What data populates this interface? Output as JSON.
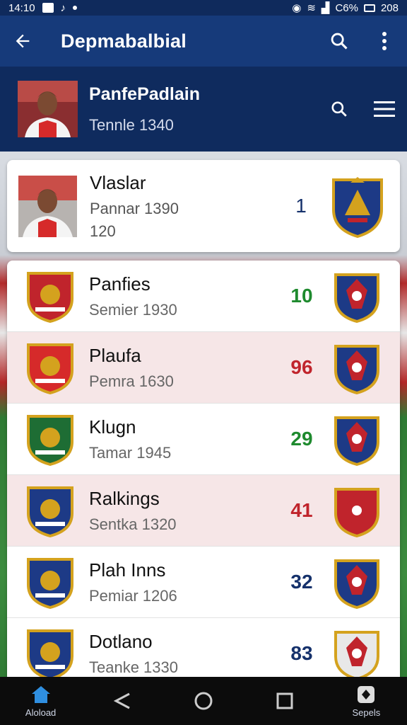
{
  "status_bar": {
    "time": "14:10",
    "battery": "C6%",
    "right_text": "208"
  },
  "app_bar": {
    "title": "Depmabalbial",
    "icons": [
      "back-arrow-icon",
      "search-icon",
      "more-vert-icon"
    ]
  },
  "profile": {
    "name": "PanfePadlain",
    "subtitle": "Tennle 1340",
    "icons": [
      "search-icon",
      "menu-icon"
    ]
  },
  "featured": {
    "name": "Vlaslar",
    "line1": "Pannar 1390",
    "line2": "120",
    "rank": "1"
  },
  "teams": [
    {
      "name": "Panfies",
      "sub": "Semier 1930",
      "value": "10",
      "color": "#1e8a2e",
      "alt": false
    },
    {
      "name": "Plaufa",
      "sub": "Pemra 1630",
      "value": "96",
      "color": "#c0242c",
      "alt": true
    },
    {
      "name": "Klugn",
      "sub": "Tamar 1945",
      "value": "29",
      "color": "#1e8a2e",
      "alt": false
    },
    {
      "name": "Ralkings",
      "sub": "Sentka 1320",
      "value": "41",
      "color": "#c0242c",
      "alt": true
    },
    {
      "name": "Plah Inns",
      "sub": "Pemiar 1206",
      "value": "32",
      "color": "#15316b",
      "alt": false
    },
    {
      "name": "Dotlano",
      "sub": "Teanke 1330",
      "value": "83",
      "color": "#15316b",
      "alt": false
    }
  ],
  "bottom_nav": [
    {
      "label": "Aloload",
      "icon": "home-icon"
    },
    {
      "label": "",
      "icon": "share-icon"
    },
    {
      "label": "",
      "icon": "circle-icon"
    },
    {
      "label": "",
      "icon": "square-icon"
    },
    {
      "label": "Sepels",
      "icon": "apps-icon"
    }
  ]
}
